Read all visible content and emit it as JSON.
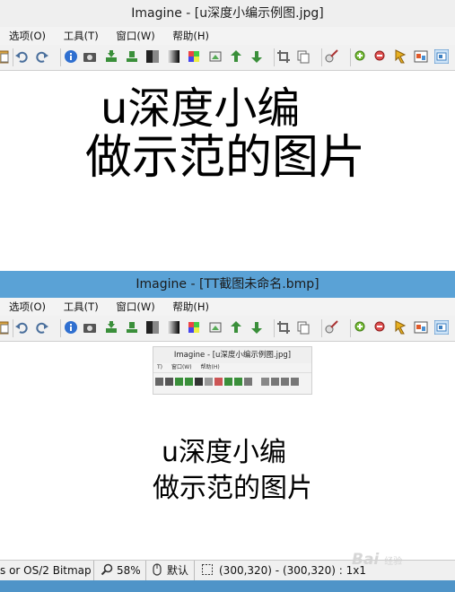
{
  "window1": {
    "title": "Imagine - [u深度小编示例图.jpg]",
    "menu": [
      "选项(O)",
      "工具(T)",
      "窗口(W)",
      "帮助(H)"
    ],
    "image_text": [
      "u深度小编",
      "做示范的图片"
    ]
  },
  "window2": {
    "title": "Imagine - [TT截图未命名.bmp]",
    "menu": [
      "选项(O)",
      "工具(T)",
      "窗口(W)",
      "帮助(H)"
    ],
    "image_text": [
      "u深度小编",
      "做示范的图片"
    ],
    "mini_window": {
      "title": "Imagine - [u深度小编示例图.jpg]",
      "menu": [
        "T)",
        "窗口(W)",
        "帮助(H)"
      ]
    },
    "status": {
      "format": "s or OS/2 Bitmap",
      "zoom": "58%",
      "mode": "默认",
      "selection": "(300,320) - (300,320) : 1x1"
    }
  },
  "watermark": {
    "text": "Bai",
    "suffix": "经验"
  },
  "toolbar_icons": [
    "paste-icon",
    "undo-icon",
    "redo-icon",
    "info-icon",
    "camera-icon",
    "import-icon",
    "export-icon",
    "grayscale-icon",
    "gradient-icon",
    "effects-icon",
    "rotate-icon",
    "flip-icon",
    "resize-icon",
    "crop-icon",
    "copy-icon",
    "brush-icon",
    "zoom-in-icon",
    "zoom-out-icon",
    "fit-icon",
    "window-icon",
    "fullscreen-icon"
  ]
}
